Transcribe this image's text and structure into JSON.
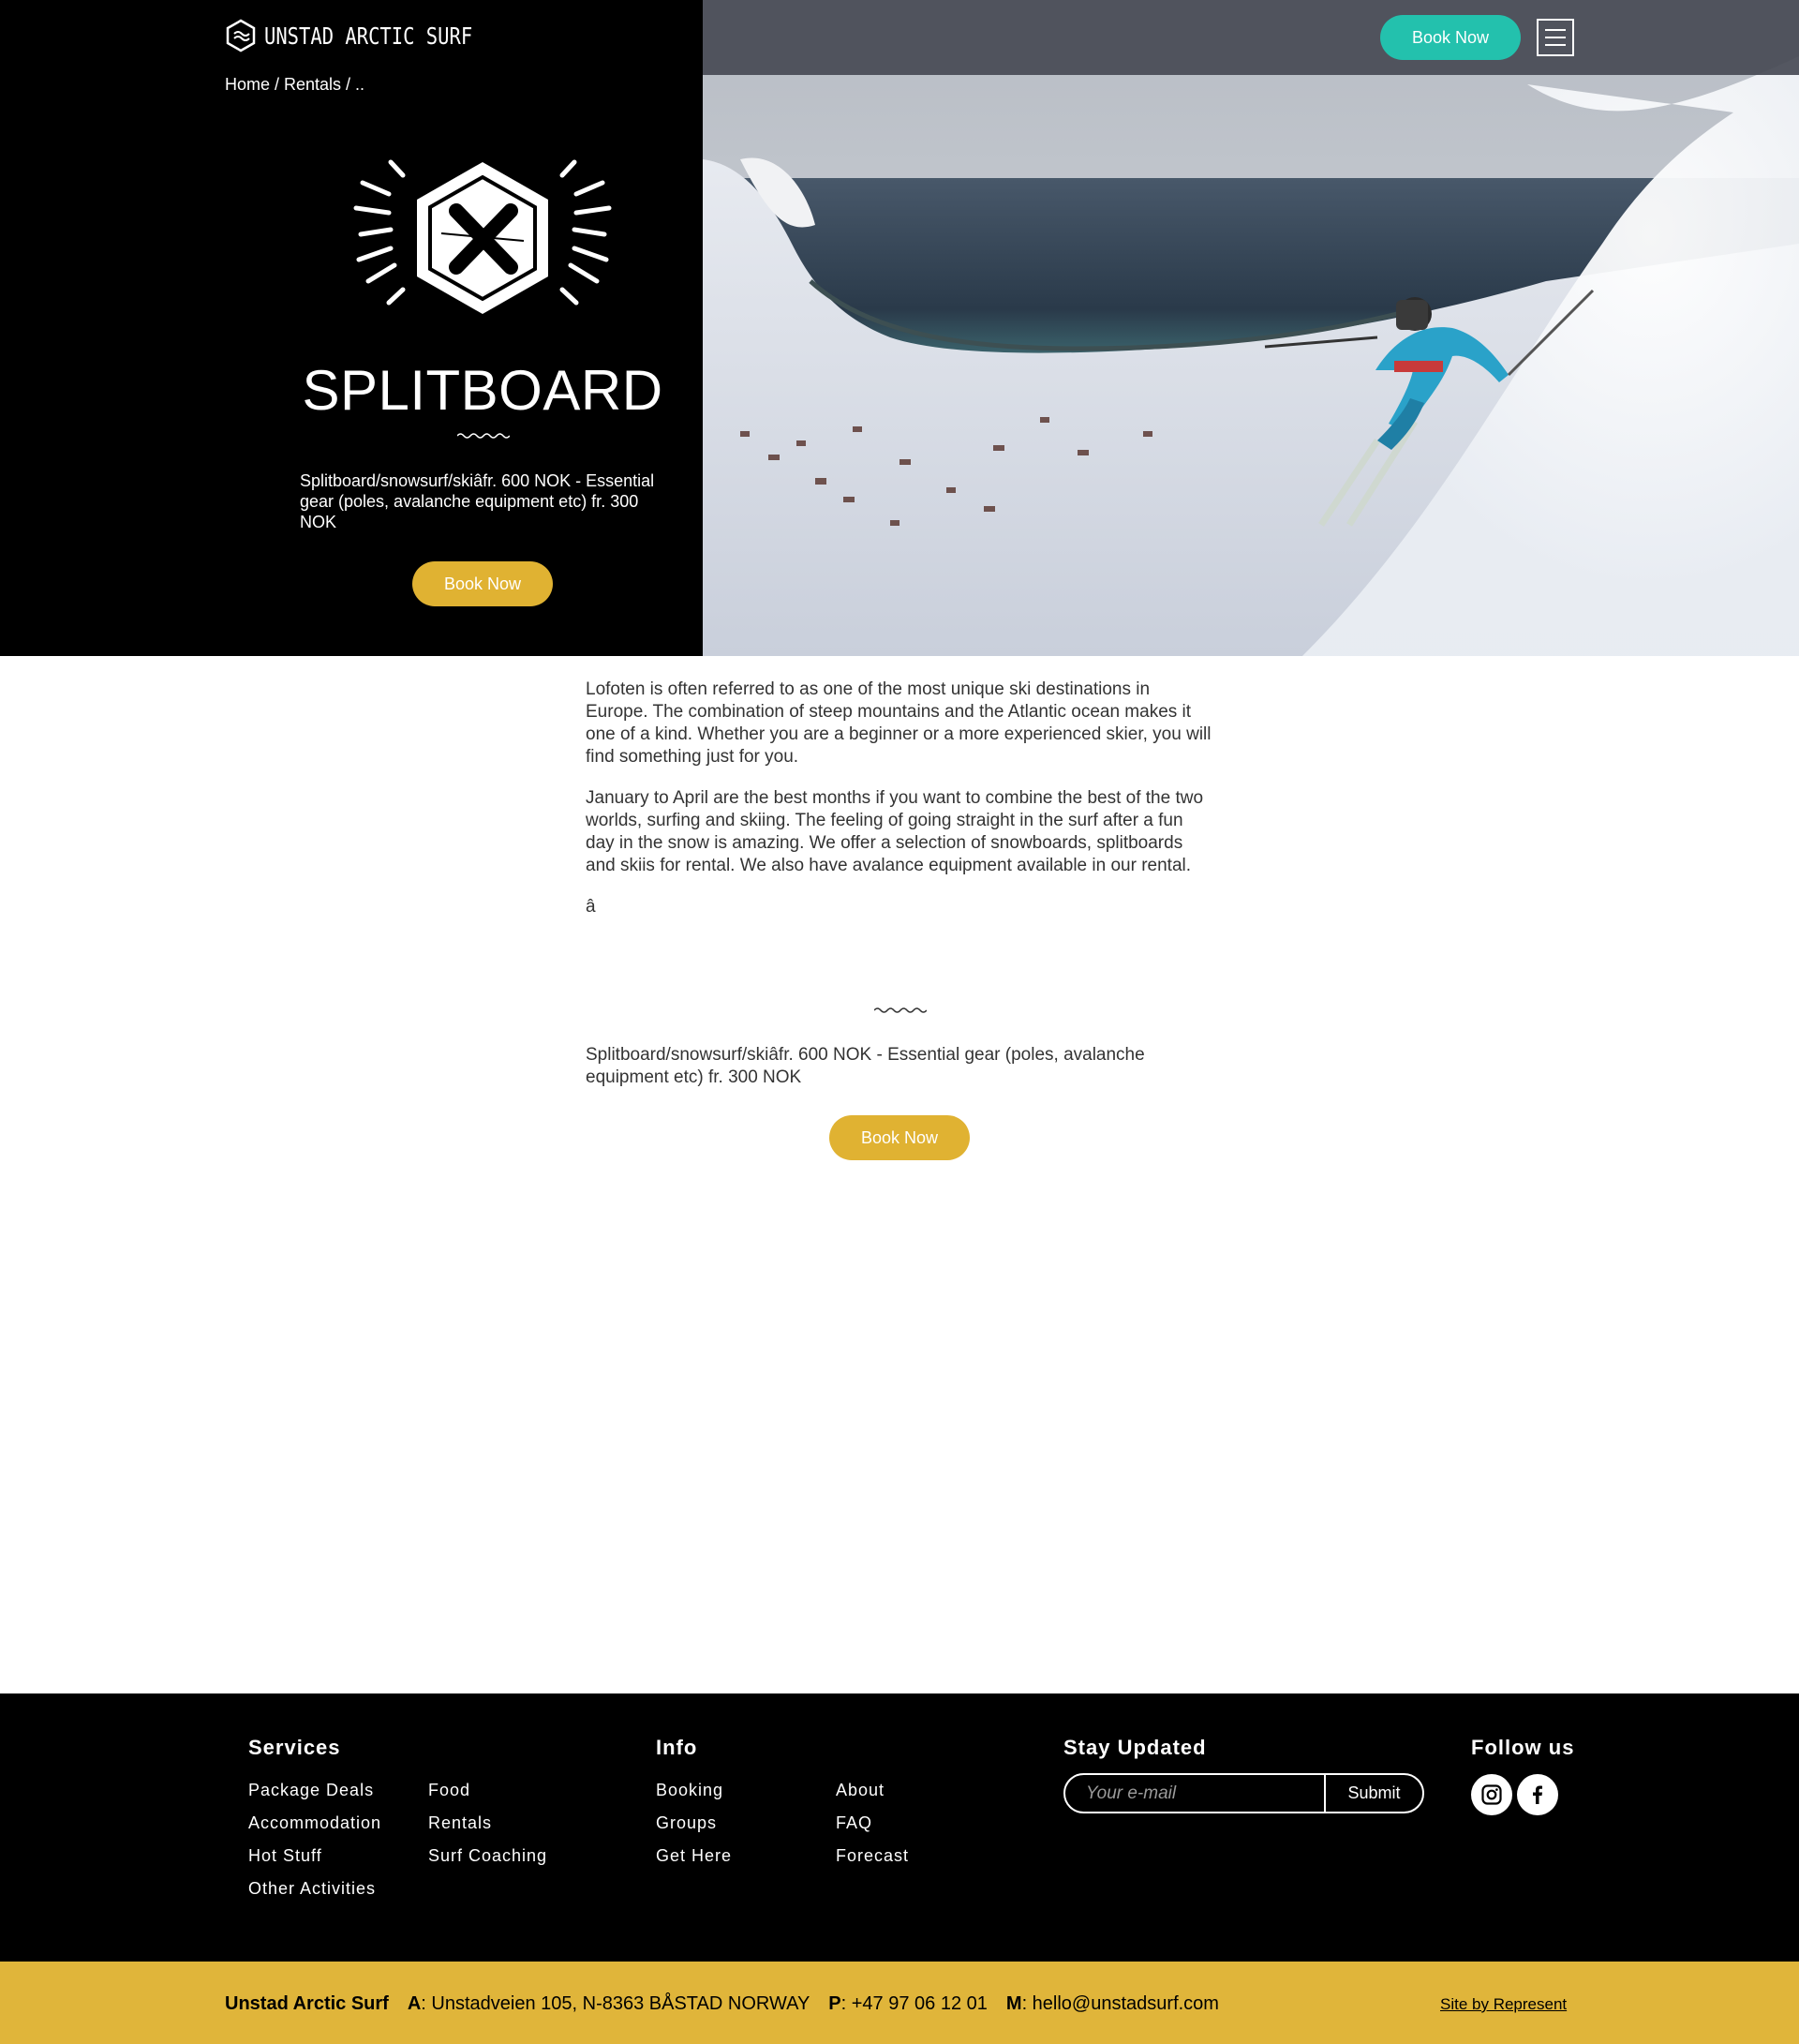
{
  "header": {
    "logo_text": "UNSTAD ARCTIC SURF",
    "breadcrumb": "Home / Rentals / ..",
    "book_now": "Book Now"
  },
  "hero": {
    "title": "SPLITBOARD",
    "description": "Splitboard/snowsurf/skiâfr. 600 NOK - Essential gear (poles, avalanche equipment etc) fr. 300 NOK",
    "book_now": "Book Now"
  },
  "content": {
    "paragraphs": [
      "Lofoten is often referred to as one of the most unique ski destinations in Europe. The combination of steep mountains and the Atlantic ocean makes it one of a kind. Whether you are a beginner or a more experienced skier, you will find something just for you.",
      "January to April are the best months if you want to combine the best of the two worlds, surfing and skiing. The feeling of going straight in the surf after a fun day in the snow is amazing. We offer a selection of snowboards, splitboards and skiis for rental. We also have avalance equipment available in our rental.",
      "â"
    ],
    "price": "Splitboard/snowsurf/skiâfr. 600 NOK - Essential gear (poles, avalanche equipment etc) fr. 300 NOK",
    "book_now": "Book Now"
  },
  "footer": {
    "services": {
      "heading": "Services",
      "col1": [
        "Package Deals",
        "Accommodation",
        "Hot Stuff",
        "Other Activities"
      ],
      "col2": [
        "Food",
        "Rentals",
        "Surf Coaching"
      ]
    },
    "info": {
      "heading": "Info",
      "col1": [
        "Booking",
        "Groups",
        "Get Here"
      ],
      "col2": [
        "About",
        "FAQ",
        "Forecast"
      ]
    },
    "newsletter": {
      "heading": "Stay Updated",
      "placeholder": "Your e-mail",
      "submit": "Submit"
    },
    "follow": {
      "heading": "Follow us",
      "icons": [
        "instagram-icon",
        "facebook-icon"
      ]
    }
  },
  "bottom_bar": {
    "company": "Unstad Arctic Surf",
    "address_label": "A",
    "address": ": Unstadveien 105, N-8363 BÅSTAD NORWAY",
    "phone_label": "P",
    "phone": ": +47 97 06 12 01",
    "mail_label": "M",
    "mail": ": hello@unstadsurf.com",
    "credit": "Site by Represent"
  },
  "colors": {
    "accent_gold": "#e0b232",
    "accent_teal": "#23c1ad",
    "footer_bg": "#000000",
    "bottom_bar_bg": "#e0b53a"
  }
}
